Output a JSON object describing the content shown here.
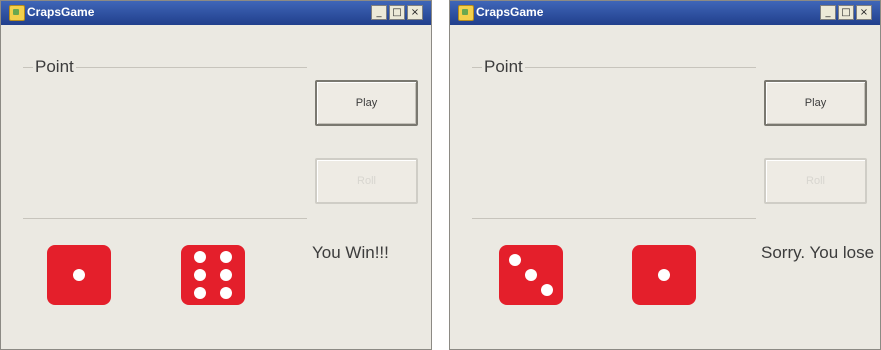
{
  "windows": [
    {
      "title": "CrapsGame",
      "point_label": "Point",
      "play_label": "Play",
      "disabled_label": "Roll",
      "die1_value": 1,
      "die2_value": 6,
      "result_text": "You Win!!!"
    },
    {
      "title": "CrapsGame",
      "point_label": "Point",
      "play_label": "Play",
      "disabled_label": "Roll",
      "die1_value": 3,
      "die2_value": 1,
      "result_text": "Sorry. You lose"
    }
  ],
  "titlebar_buttons": [
    "_",
    "□",
    "×"
  ],
  "colors": {
    "titlebar": "#2b4fa0",
    "window_bg": "#ebe9e2",
    "die": "#e41f2b",
    "pip": "#ffffff"
  }
}
